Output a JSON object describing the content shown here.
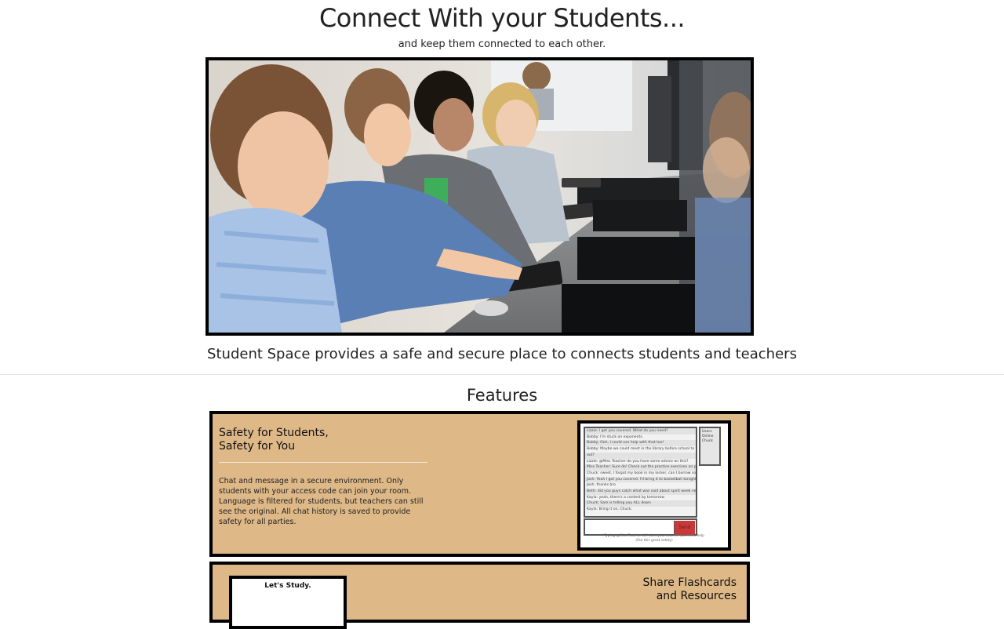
{
  "hero": {
    "title": "Connect With your Students...",
    "subtitle": "and keep them connected to each other.",
    "image_alt": "Students working at computers in a classroom"
  },
  "tagline": "Student Space provides a safe and secure place to connects students and teachers",
  "features": {
    "heading": "Features",
    "cards": [
      {
        "title_line1": "Safety for Students,",
        "title_line2": "Safety for You",
        "body": "Chat and message in a secure environment. Only students with your access code can join your room. Language is filtered for students, but teachers can still see the original. All chat history is saved to provide safety for all parties.",
        "preview": {
          "chat_lines": [
            "Lizzie: I got you covered. What do you need?",
            "Bobby: I'm stuck on exponents.",
            "Bobby: Ooh, I could use help with that too!",
            "Bobby: Maybe we could meet in the library before school to talk it",
            "out?",
            "Lizzie: @Miss Teacher do you have some advice on this?",
            "Miss Teacher: Sure do! Check out the practice exercises on pg 108.",
            "Chuck: sweet, I forgot my book in my locker, can I borrow someone's?",
            "Josh: Yeah I got you covered. I'll bring it to basketball tonight.",
            "Josh: thanks bro",
            "Beth: did you guys catch what was said about spirit week next week?",
            "Kayla: yeah, there's a contest by tomorrow",
            "Chuck: Sam is telling you ALL down",
            "Kayla: Bring it on, Chuck."
          ],
          "online_label": "Users Online",
          "online_user": "Chuck",
          "send_label": "Send",
          "typing_note": "Typing @Miss Teacher will alert your teacher you need help",
          "typing_note2": "(like this great safety)"
        }
      },
      {
        "preview_title": "Let's Study.",
        "title_line1": "Share Flashcards",
        "title_line2": "and Resources"
      }
    ]
  },
  "colors": {
    "card_background": "#deb887",
    "card_border": "#000000",
    "send_button": "#c83a3a"
  }
}
